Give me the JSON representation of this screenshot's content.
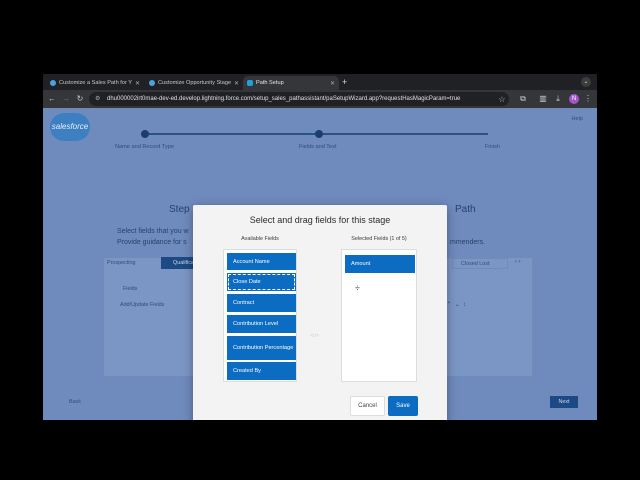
{
  "browser": {
    "tabs": [
      {
        "label": "Customize a Sales Path for Y",
        "active": false
      },
      {
        "label": "Customize Opportunity Stage",
        "active": false
      },
      {
        "label": "Path Setup",
        "active": true
      }
    ],
    "url": "dhu000002irt0mae-dev-ed.develop.lightning.force.com/setup_sales_pathassistant/paSetupWizard.app?requestHasMagicParam=true",
    "profile_initial": "N"
  },
  "page": {
    "logo": "salesforce",
    "help": "Help",
    "wizard_steps": [
      "Name and Record Type",
      "Fields and Text",
      "Finish"
    ],
    "step_title": "Step",
    "path_title": "Path",
    "description_line1": "Select fields that you w",
    "description_line2": "Provide guidance for s",
    "description_end": "mmenders.",
    "stage_tabs": [
      "Prospecting",
      "Qualificati"
    ],
    "selector_label": "Closed Lost",
    "fields_label": "Fields",
    "add_fields_link": "Add/Update Fields",
    "back_label": "Back",
    "next_label": "Next"
  },
  "modal": {
    "title": "Select and drag fields for this stage",
    "available_title": "Available Fields",
    "selected_title": "Selected Fields (1 of 5)",
    "available_fields": [
      "Account Name",
      "Close Date",
      "Contract",
      "Contribution Level",
      "Contribution Percentage",
      "Created By"
    ],
    "selected_fields": [
      "Amount"
    ],
    "cancel_label": "Cancel",
    "save_label": "Save"
  },
  "colors": {
    "field_blue": "#0b6cc2",
    "overlay": "#6f8bbd"
  }
}
